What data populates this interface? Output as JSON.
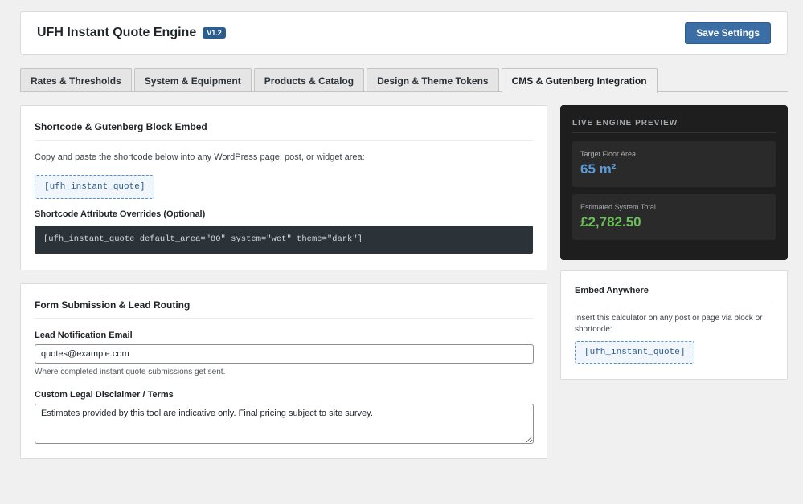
{
  "header": {
    "title": "UFH Instant Quote Engine",
    "version": "V1.2",
    "save_label": "Save Settings"
  },
  "tabs": [
    {
      "label": "Rates & Thresholds",
      "active": false
    },
    {
      "label": "System & Equipment",
      "active": false
    },
    {
      "label": "Products & Catalog",
      "active": false
    },
    {
      "label": "Design & Theme Tokens",
      "active": false
    },
    {
      "label": "CMS & Gutenberg Integration",
      "active": true
    }
  ],
  "embed": {
    "title": "Shortcode & Gutenberg Block Embed",
    "description": "Copy and paste the shortcode below into any WordPress page, post, or widget area:",
    "shortcode": "[ufh_instant_quote]",
    "overrides_label": "Shortcode Attribute Overrides (Optional)",
    "overrides_example": "[ufh_instant_quote default_area=\"80\" system=\"wet\" theme=\"dark\"]"
  },
  "form": {
    "title": "Form Submission & Lead Routing",
    "email_label": "Lead Notification Email",
    "email_value": "quotes@example.com",
    "email_hint": "Where completed instant quote submissions get sent.",
    "disclaimer_label": "Custom Legal Disclaimer / Terms",
    "disclaimer_value": "Estimates provided by this tool are indicative only. Final pricing subject to site survey."
  },
  "preview": {
    "title": "LIVE ENGINE PREVIEW",
    "area_label": "Target Floor Area",
    "area_value": "65 m²",
    "total_label": "Estimated System Total",
    "total_value": "£2,782.50"
  },
  "embed_anywhere": {
    "title": "Embed Anywhere",
    "description": "Insert this calculator on any post or page via block or shortcode:",
    "shortcode": "[ufh_instant_quote]"
  },
  "colors": {
    "accent": "#3a6ea5",
    "preview_bg": "#1e1e1e",
    "area_value": "#5a9bd8",
    "total_value": "#6bbf59"
  }
}
